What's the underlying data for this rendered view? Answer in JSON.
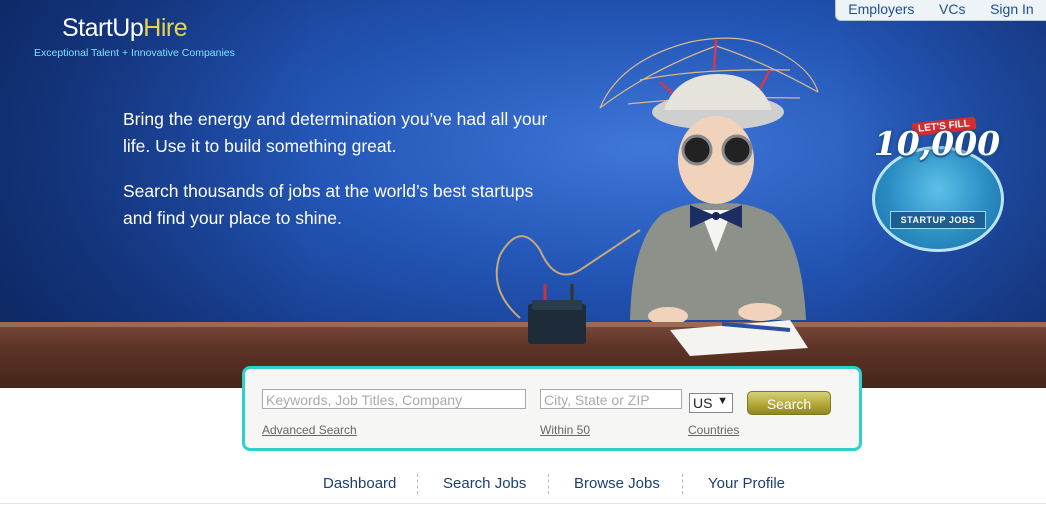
{
  "brand": {
    "name_part1": "StartUp",
    "name_part2": "Hire",
    "tagline": "Exceptional Talent + Innovative Companies"
  },
  "top_nav": [
    "Employers",
    "VCs",
    "Sign In"
  ],
  "hero": {
    "paragraph1": "Bring the energy and determination you’ve had all your life. Use it to build something great.",
    "paragraph2": "Search thousands of jobs at the world’s best startups and find your place to shine."
  },
  "badge": {
    "top": "LET'S FILL",
    "number": "10,000",
    "ribbon": "STARTUP JOBS"
  },
  "search": {
    "keywords_placeholder": "Keywords, Job Titles, Company",
    "location_placeholder": "City, State or ZIP",
    "country_value": "US",
    "button_label": "Search",
    "advanced_link": "Advanced Search",
    "radius_link": "Within 50",
    "countries_link": "Countries"
  },
  "bottom_nav": [
    "Dashboard",
    "Search Jobs",
    "Browse Jobs",
    "Your Profile"
  ],
  "colors": {
    "accent_cyan": "#2fd0cb",
    "brand_yellow": "#e8d44a",
    "nav_blue": "#1d4f93",
    "button_olive": "#b3a93a"
  }
}
